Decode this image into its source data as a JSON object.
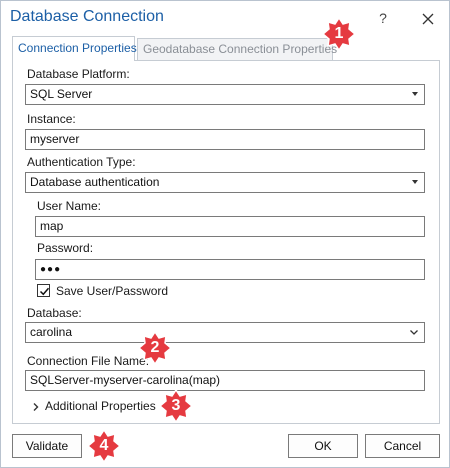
{
  "window": {
    "title": "Database Connection",
    "help_label": "?",
    "close_icon": "close-icon"
  },
  "tabs": [
    {
      "label": "Connection Properties",
      "active": true
    },
    {
      "label": "Geodatabase Connection Properties",
      "active": false
    }
  ],
  "form": {
    "database_platform": {
      "label": "Database Platform:",
      "value": "SQL Server"
    },
    "instance": {
      "label": "Instance:",
      "value": "myserver"
    },
    "authentication_type": {
      "label": "Authentication Type:",
      "value": "Database authentication"
    },
    "user_name": {
      "label": "User Name:",
      "value": "map"
    },
    "password": {
      "label": "Password:",
      "value": "●●●"
    },
    "save_user_password": {
      "label": "Save User/Password",
      "checked": true
    },
    "database": {
      "label": "Database:",
      "value": "carolina"
    },
    "connection_file_name": {
      "label": "Connection File Name:",
      "value": "SQLServer-myserver-carolina(map)"
    },
    "additional_properties": {
      "label": "Additional Properties"
    }
  },
  "buttons": {
    "validate": "Validate",
    "ok": "OK",
    "cancel": "Cancel"
  },
  "callouts": [
    "1",
    "2",
    "3",
    "4"
  ],
  "colors": {
    "accent": "#1c5fa6",
    "callout": "#e53a40"
  }
}
